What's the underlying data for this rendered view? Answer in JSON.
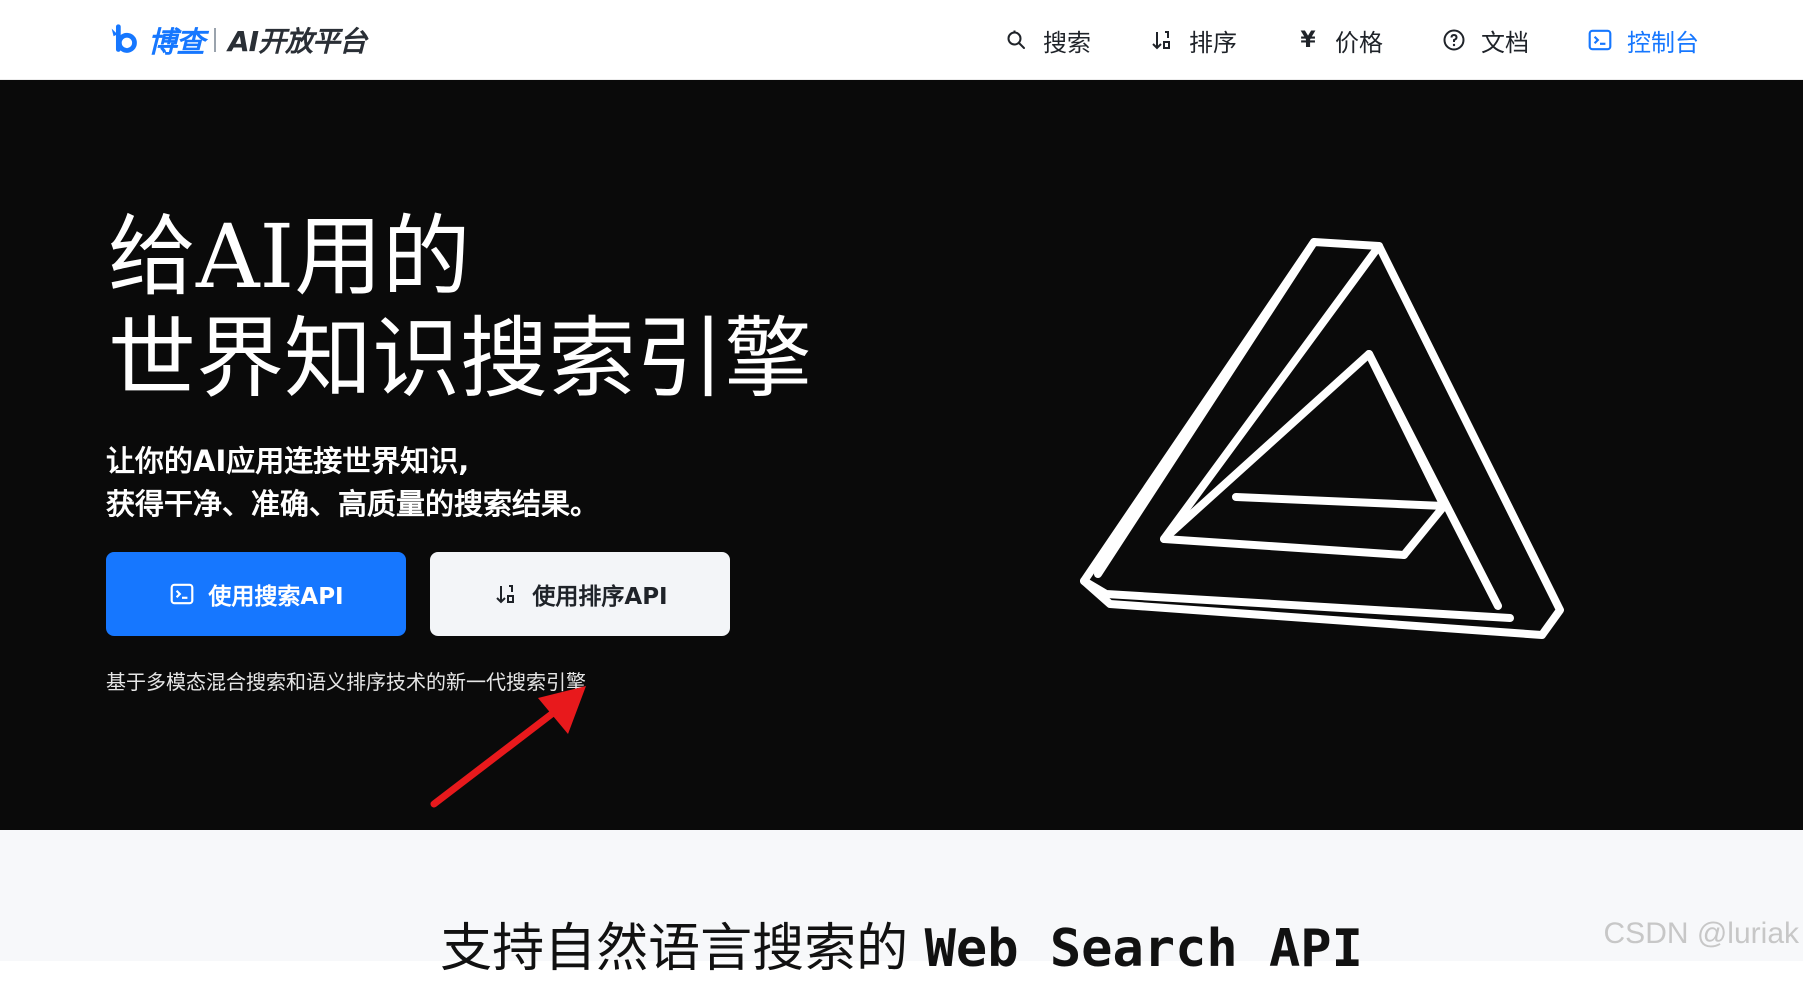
{
  "header": {
    "brand": {
      "name": "博查",
      "subtitle": "AI开放平台"
    },
    "nav": [
      {
        "label": "搜索",
        "icon": "search-icon"
      },
      {
        "label": "排序",
        "icon": "sort-icon"
      },
      {
        "label": "价格",
        "icon": "yen-icon"
      },
      {
        "label": "文档",
        "icon": "help-circle-icon"
      },
      {
        "label": "控制台",
        "icon": "console-icon",
        "active": true
      }
    ]
  },
  "hero": {
    "title_line1": "给AI用的",
    "title_line2": "世界知识搜索引擎",
    "subtitle_line1": "让你的AI应用连接世界知识,",
    "subtitle_line2": "获得干净、准确、高质量的搜索结果。",
    "primary_button": "使用搜索API",
    "secondary_button": "使用排序API",
    "note": "基于多模态混合搜索和语义排序技术的新一代搜索引擎"
  },
  "section2": {
    "title_cn": "支持自然语言搜索的",
    "title_en": "Web Search API"
  },
  "watermark": "CSDN @luriak",
  "colors": {
    "accent": "#1677ff",
    "hero_bg": "#0a0a0a",
    "annotation_arrow": "#e8191c"
  }
}
